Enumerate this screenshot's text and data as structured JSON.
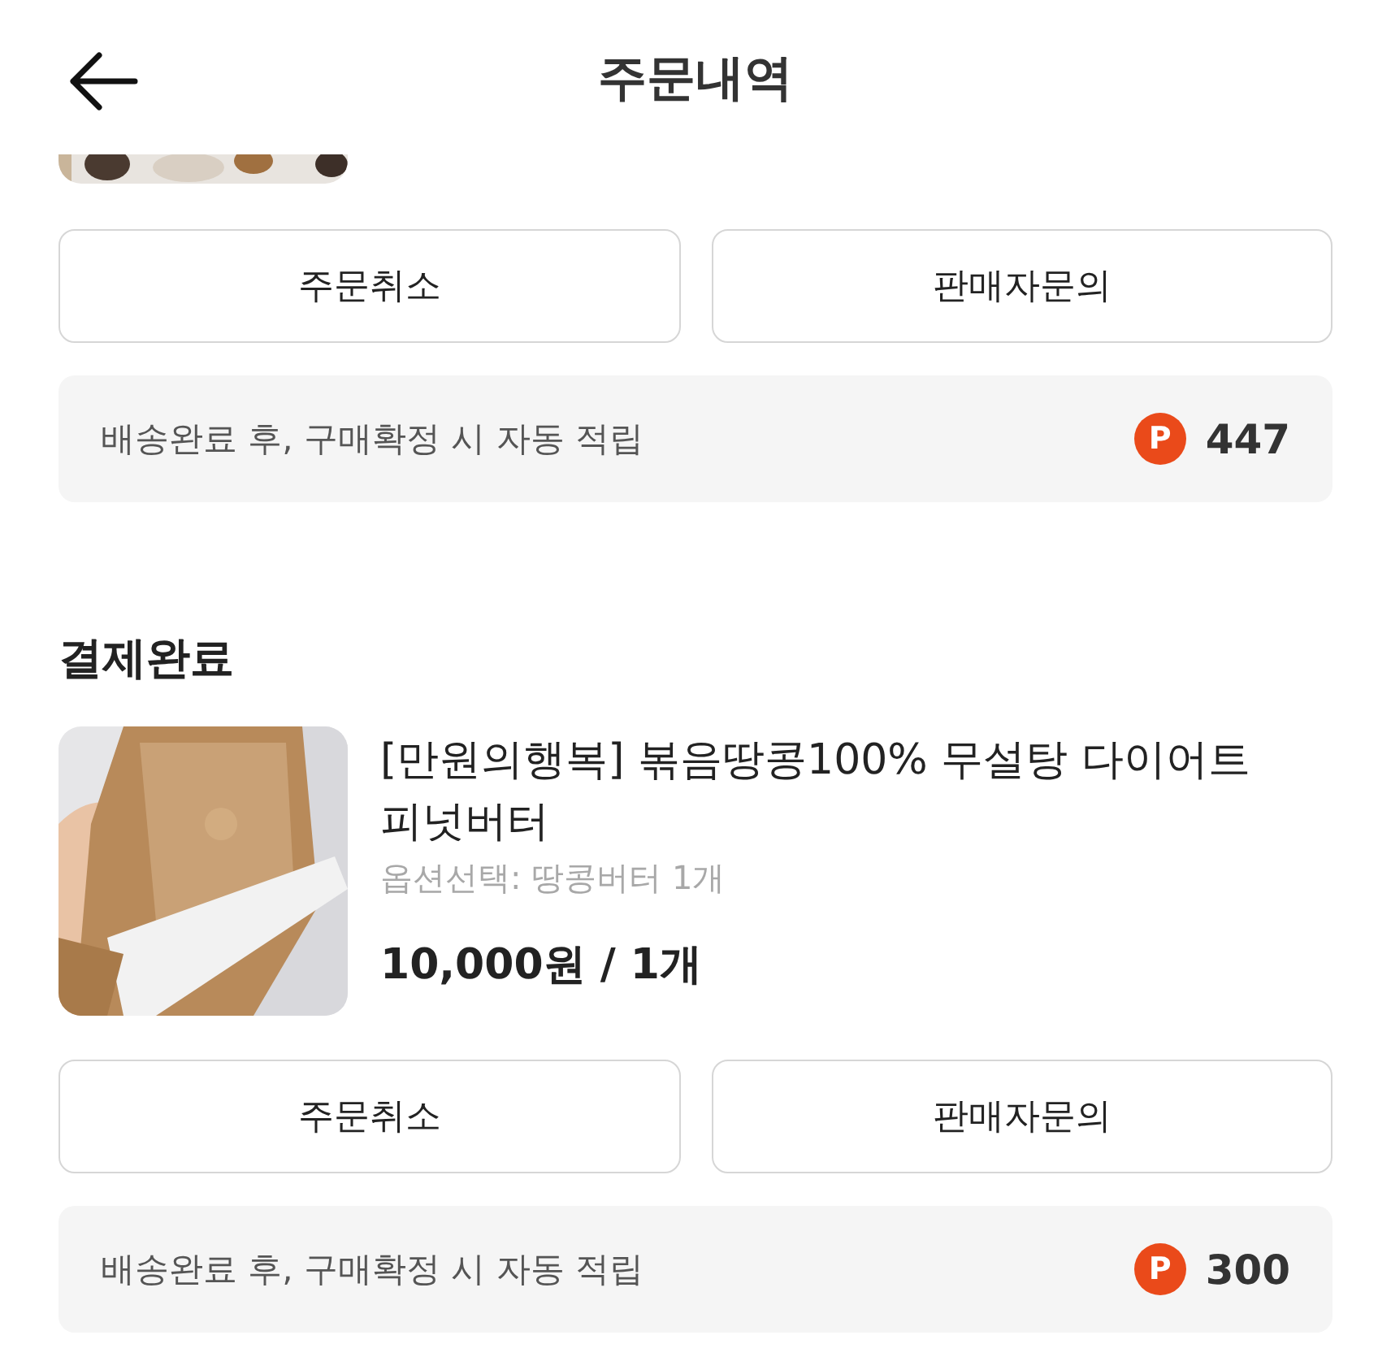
{
  "header": {
    "title": "주문내역"
  },
  "orders": [
    {
      "kind": "cut-off",
      "buttons": [
        "주문취소",
        "판매자문의"
      ],
      "points": {
        "note": "배송완료 후, 구매확정 시 자동 적립",
        "badge": "P",
        "amount": "447"
      }
    },
    {
      "kind": "full",
      "status": "결제완료",
      "product": {
        "title": "[만원의행복] 볶음땅콩100% 무설탕 다이어트 피넛버터",
        "option": "옵션선택: 땅콩버터 1개",
        "price": "10,000원 / 1개"
      },
      "buttons": [
        "주문취소",
        "판매자문의"
      ],
      "points": {
        "note": "배송완료 후, 구매확정 시 자동 적립",
        "badge": "P",
        "amount": "300"
      }
    }
  ]
}
